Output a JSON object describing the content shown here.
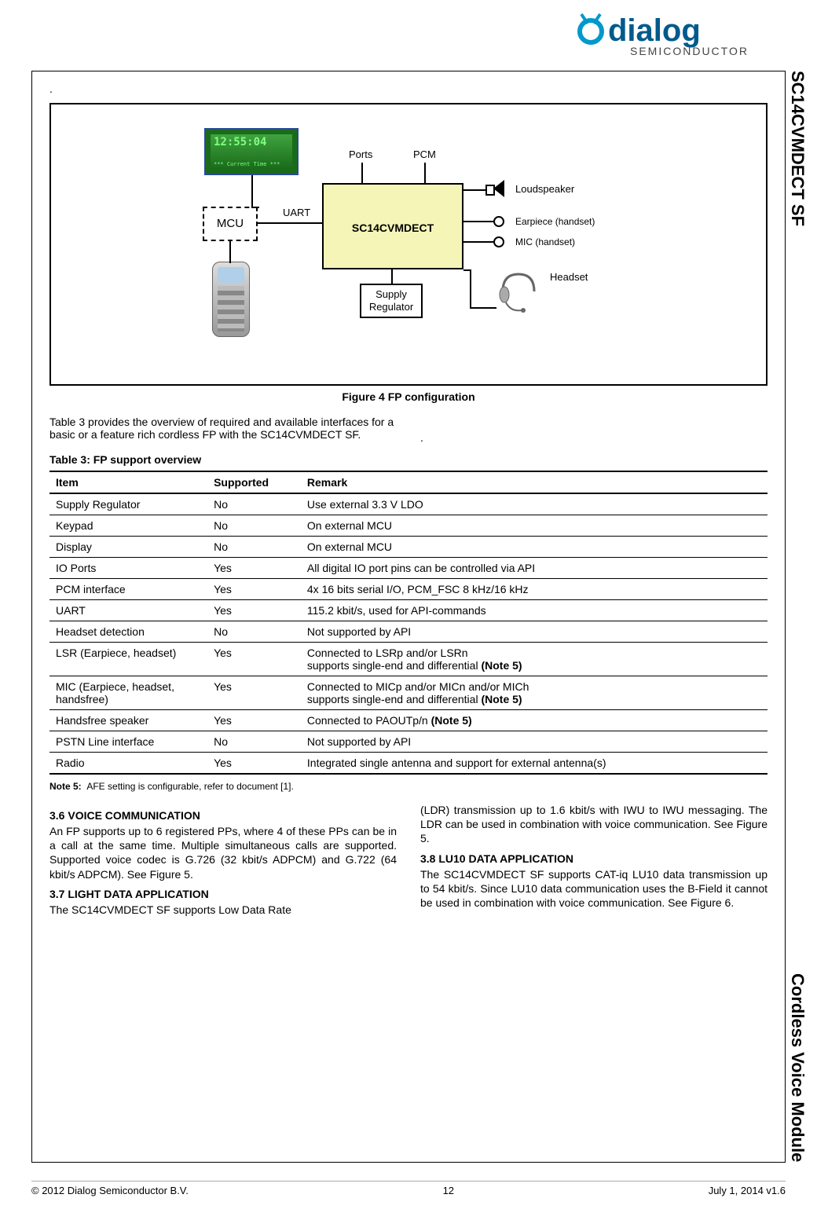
{
  "logo": {
    "brand": "dialog",
    "sub": "SEMICONDUCTOR"
  },
  "side_labels": {
    "top": "SC14CVMDECT SF",
    "bottom": "Cordless Voice Module"
  },
  "figure": {
    "caption": "Figure 4  FP configuration",
    "labels": {
      "ports": "Ports",
      "pcm": "PCM",
      "uart": "UART",
      "mcu": "MCU",
      "main": "SC14CVMDECT",
      "supply": "Supply Regulator",
      "loudspeaker": "Loudspeaker",
      "earpiece": "Earpiece (handset)",
      "mic": "MIC (handset)",
      "headset": "Headset",
      "lcd_time": "12:55:04",
      "lcd_sub": "*** Current Time ***"
    }
  },
  "intro": {
    "para": "Table 3 provides the overview of required and available interfaces for a basic or a feature rich cordless FP with the SC14CVMDECT SF.",
    "dot": "."
  },
  "table": {
    "caption": "Table 3: FP support overview",
    "headers": {
      "item": "Item",
      "supported": "Supported",
      "remark": "Remark"
    },
    "rows": [
      {
        "item": "Supply Regulator",
        "supported": "No",
        "remark": "Use external 3.3 V LDO"
      },
      {
        "item": "Keypad",
        "supported": "No",
        "remark": "On external MCU"
      },
      {
        "item": "Display",
        "supported": "No",
        "remark": "On external MCU"
      },
      {
        "item": "IO Ports",
        "supported": "Yes",
        "remark": "All digital IO port pins can be controlled via API"
      },
      {
        "item": "PCM interface",
        "supported": "Yes",
        "remark": "4x 16 bits serial I/O, PCM_FSC 8 kHz/16 kHz"
      },
      {
        "item": "UART",
        "supported": "Yes",
        "remark": "115.2 kbit/s, used for API-commands"
      },
      {
        "item": "Headset detection",
        "supported": "No",
        "remark": "Not supported by API"
      },
      {
        "item": "LSR (Earpiece, headset)",
        "supported": "Yes",
        "remark_html": "Connected to LSRp and/or LSRn<br>supports single-end and differential <b>(Note 5)</b>"
      },
      {
        "item": "MIC (Earpiece, headset, handsfree)",
        "supported": "Yes",
        "remark_html": "Connected to MICp and/or MICn and/or MICh<br>supports single-end and differential <b>(Note 5)</b>"
      },
      {
        "item": "Handsfree speaker",
        "supported": "Yes",
        "remark_html": "Connected to PAOUTp/n <b>(Note 5)</b>"
      },
      {
        "item": "PSTN Line interface",
        "supported": "No",
        "remark": "Not supported by API"
      },
      {
        "item": "Radio",
        "supported": "Yes",
        "remark": "Integrated single antenna and support for external antenna(s)"
      }
    ]
  },
  "note": {
    "label": "Note 5:",
    "text": "AFE setting is configurable, refer to document [1]."
  },
  "sections": {
    "s36": {
      "head": "3.6  VOICE COMMUNICATION",
      "body": "An FP supports up to 6 registered PPs, where 4 of these PPs can be in a call at the same time. Multiple simultaneous calls are supported. Supported voice codec is G.726 (32 kbit/s ADPCM) and G.722 (64 kbit/s ADPCM). See Figure 5."
    },
    "s37": {
      "head": "3.7  LIGHT DATA APPLICATION",
      "body_lead": "The SC14CVMDECT SF supports Low Data Rate",
      "body_cont": "(LDR) transmission up to 1.6 kbit/s with IWU to IWU messaging. The LDR can be used in combination with voice communication. See Figure 5."
    },
    "s38": {
      "head": "3.8  LU10 DATA APPLICATION",
      "body": "The SC14CVMDECT SF supports CAT-iq LU10 data transmission up to 54 kbit/s. Since LU10 data communication uses the B-Field it cannot be used in combination with voice communication. See Figure 6."
    }
  },
  "footer": {
    "copyright": "© 2012 Dialog Semiconductor B.V.",
    "page": "12",
    "date": "July 1, 2014 v1.6"
  }
}
